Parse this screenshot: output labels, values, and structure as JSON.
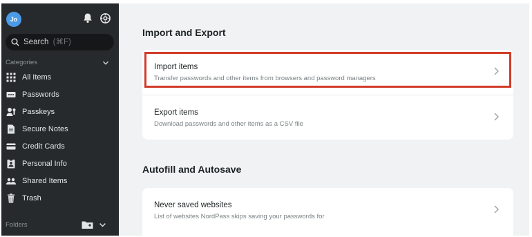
{
  "user": {
    "initials": "Jo"
  },
  "search": {
    "label": "Search",
    "shortcut": "(⌘F)"
  },
  "sidebar": {
    "categories_label": "Categories",
    "items": [
      {
        "label": "All Items",
        "icon": "grid-icon"
      },
      {
        "label": "Passwords",
        "icon": "password-icon"
      },
      {
        "label": "Passkeys",
        "icon": "passkey-icon"
      },
      {
        "label": "Secure Notes",
        "icon": "note-icon"
      },
      {
        "label": "Credit Cards",
        "icon": "credit-card-icon"
      },
      {
        "label": "Personal Info",
        "icon": "id-card-icon"
      },
      {
        "label": "Shared Items",
        "icon": "people-icon"
      },
      {
        "label": "Trash",
        "icon": "trash-icon"
      }
    ],
    "folders_label": "Folders"
  },
  "main": {
    "import_export": {
      "heading": "Import and Export",
      "import": {
        "title": "Import items",
        "desc": "Transfer passwords and other items from browsers and password managers"
      },
      "export": {
        "title": "Export items",
        "desc": "Download passwords and other items as a CSV file"
      }
    },
    "autofill": {
      "heading": "Autofill and Autosave",
      "never_saved": {
        "title": "Never saved websites",
        "desc": "List of websites NordPass skips saving your passwords for"
      }
    }
  },
  "colors": {
    "sidebar": "#262a2c",
    "main_bg": "#f0f2f3",
    "highlight": "#d23a28",
    "avatar": "#4c9be8"
  }
}
